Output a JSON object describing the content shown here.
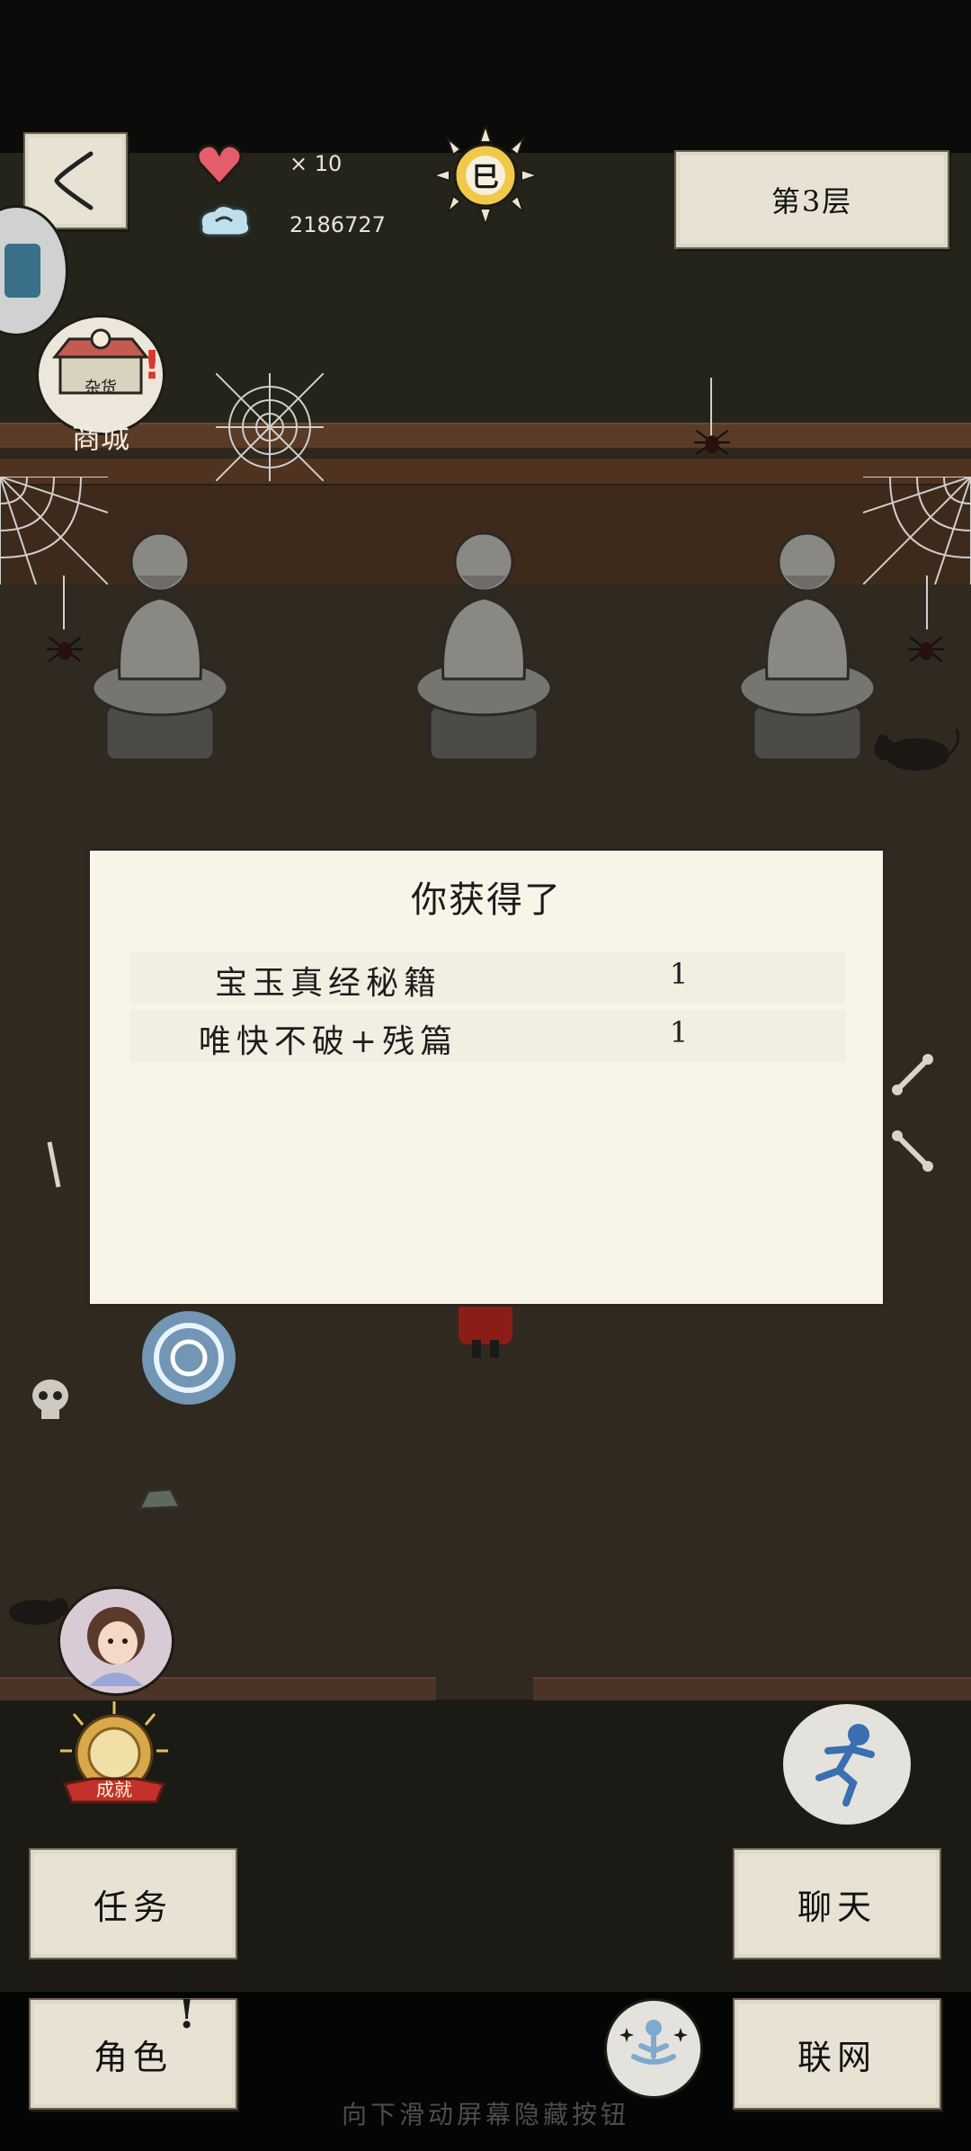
{
  "hud": {
    "lives_label": "× 10",
    "currency_value": "2186727",
    "time_glyph": "巳",
    "floor_label": "第3层",
    "heart_color": "#e35d6a",
    "ui_paper_color": "#e7e2d3"
  },
  "shop": {
    "label": "商城",
    "sign_text": "杂货"
  },
  "dialog": {
    "title": "你获得了",
    "rewards": [
      {
        "name": "宝玉真经秘籍",
        "qty": "1"
      },
      {
        "name": "唯快不破+残篇",
        "qty": "1"
      }
    ]
  },
  "achievement": {
    "label": "成就"
  },
  "buttons": {
    "task": "任务",
    "chat": "聊天",
    "role": "角色",
    "network": "联网"
  },
  "hint": "向下滑动屏幕隐藏按钮"
}
